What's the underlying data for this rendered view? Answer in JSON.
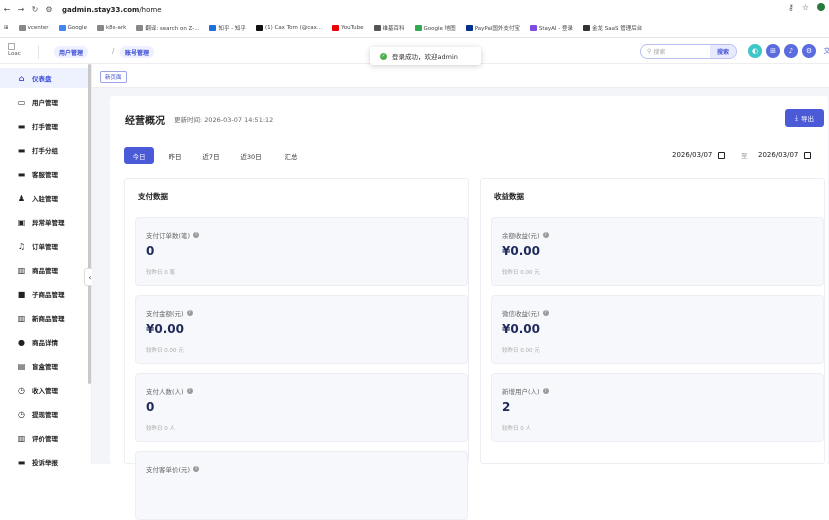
{
  "browser": {
    "url_site": "gadmin.stay33.com",
    "url_path": "/home",
    "bookmarks": [
      "vcenter",
      "Google",
      "k8s-ark",
      "翻译: search on Z-...",
      "知乎 - 知乎",
      "(1) Cax Tom (@cax...",
      "YouTube",
      "维基百科",
      "Google 地图",
      "PayPal国外支付宝",
      "StayAI - 登录",
      "金龙 SaaS 管理后台"
    ]
  },
  "header": {
    "logo_text": "Loac",
    "breadcrumbs": [
      "用户管理",
      "账号管理"
    ],
    "search_placeholder": "搜索",
    "search_button": "搜索"
  },
  "toast": {
    "text": "登录成功，欢迎admin"
  },
  "sidebar": {
    "items": [
      {
        "label": "仪表盘",
        "icon": "⌂"
      },
      {
        "label": "用户管理",
        "icon": "▭"
      },
      {
        "label": "打手管理",
        "icon": "▬"
      },
      {
        "label": "打手分组",
        "icon": "▬"
      },
      {
        "label": "客服管理",
        "icon": "▬"
      },
      {
        "label": "入驻管理",
        "icon": "♟"
      },
      {
        "label": "异常单管理",
        "icon": "▣"
      },
      {
        "label": "订单管理",
        "icon": "♫"
      },
      {
        "label": "商品管理",
        "icon": "▥"
      },
      {
        "label": "子商品管理",
        "icon": "■"
      },
      {
        "label": "新商品管理",
        "icon": "▥"
      },
      {
        "label": "商品详情",
        "icon": "●"
      },
      {
        "label": "盲盒管理",
        "icon": "▤"
      },
      {
        "label": "收入管理",
        "icon": "◷"
      },
      {
        "label": "提现管理",
        "icon": "◷"
      },
      {
        "label": "评价管理",
        "icon": "▥"
      },
      {
        "label": "投诉举报",
        "icon": "▬"
      }
    ]
  },
  "tabs": {
    "active_tag": "新页面"
  },
  "overview": {
    "title": "经营概况",
    "updated": "更新时间: 2026-03-07 14:51:12",
    "export_label": "导出",
    "ranges": [
      "今日",
      "昨日",
      "近7日",
      "近30日",
      "汇总"
    ],
    "date_from": "2026/03/07",
    "date_to": "2026/03/07",
    "date_sep": "至"
  },
  "payment": {
    "title": "支付数据",
    "stats": [
      {
        "label": "支付订单数(笔)",
        "value": "0",
        "sub": "较昨日 0 笔"
      },
      {
        "label": "支付金额(元)",
        "value": "¥0.00",
        "sub": "较昨日 0.00 元"
      },
      {
        "label": "支付人数(人)",
        "value": "0",
        "sub": "较昨日 0 人"
      },
      {
        "label": "支付客单价(元)",
        "value": "",
        "sub": ""
      }
    ]
  },
  "income": {
    "title": "收益数据",
    "stats": [
      {
        "label": "余额收益(元)",
        "value": "¥0.00",
        "sub": "较昨日 0.00 元"
      },
      {
        "label": "微信收益(元)",
        "value": "¥0.00",
        "sub": "较昨日 0.00 元"
      },
      {
        "label": "新增用户(人)",
        "value": "2",
        "sub": "较昨日 0 人"
      }
    ]
  }
}
